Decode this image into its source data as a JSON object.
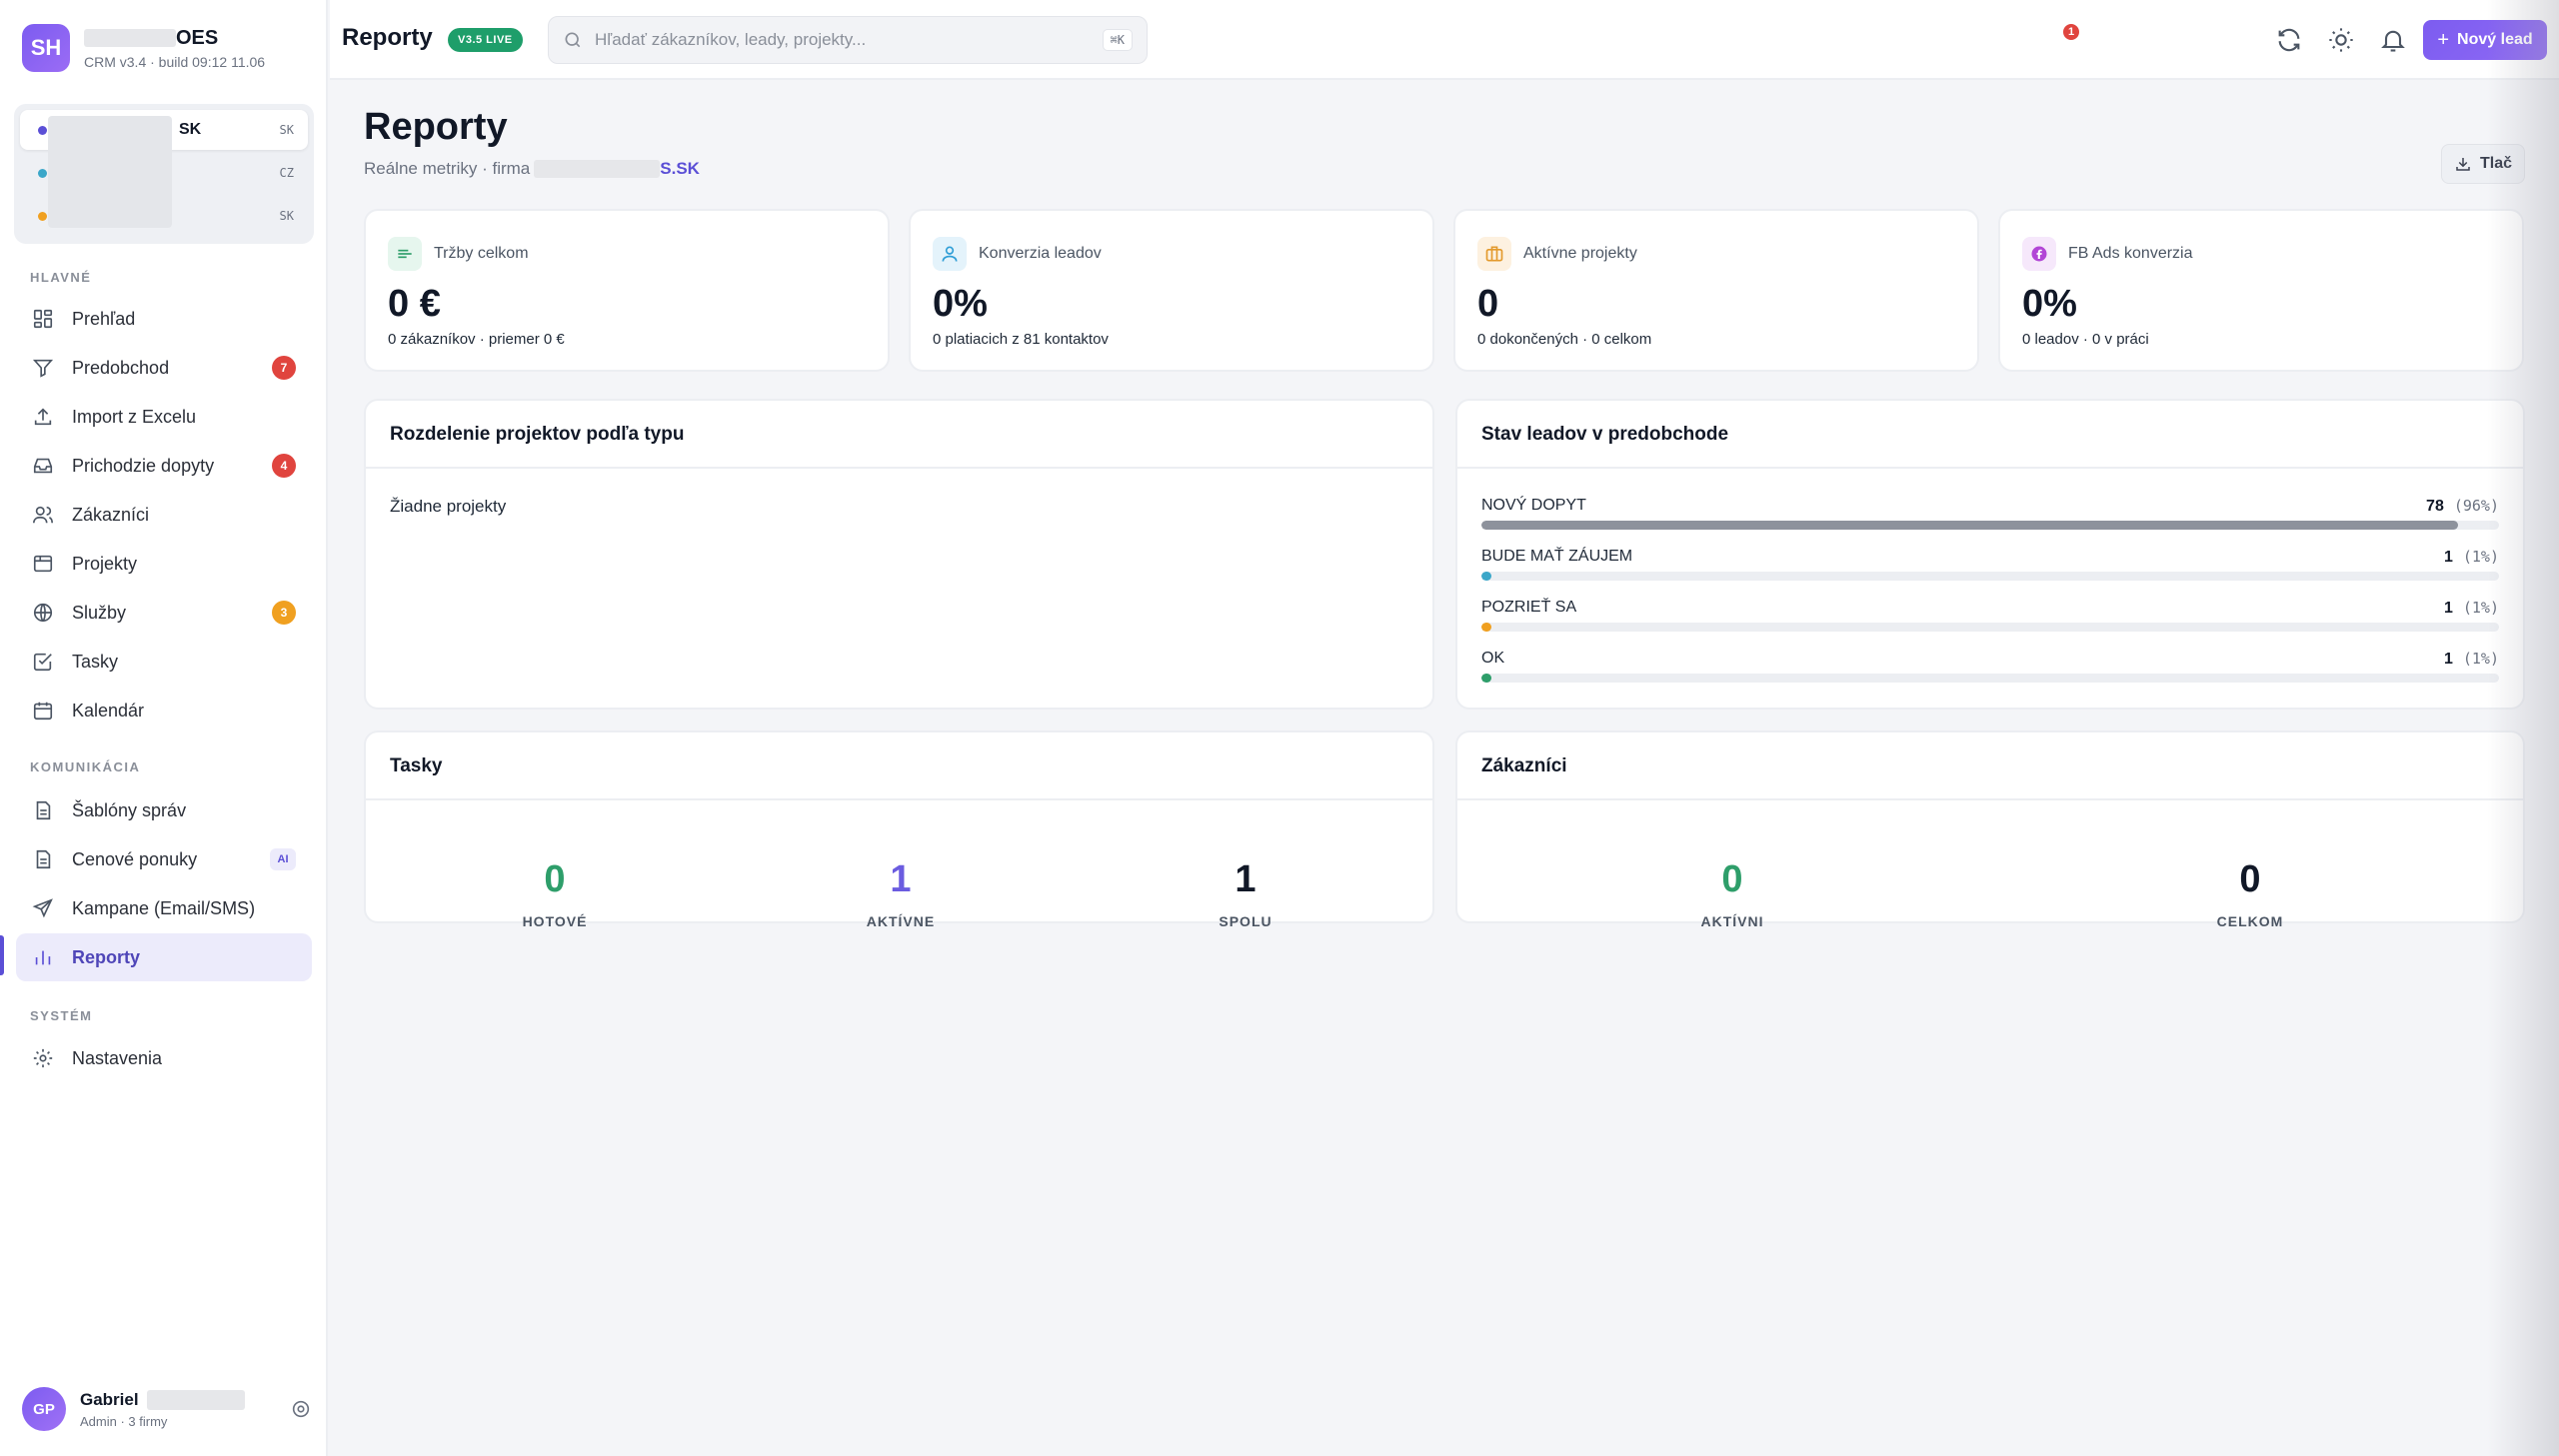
{
  "brand": {
    "initials": "SH",
    "name_suffix": "OES",
    "subtitle": "CRM v3.4 · build 09:12 11.06"
  },
  "companies": [
    {
      "name": "SK",
      "code": "SK",
      "color": "#5b4fd6"
    },
    {
      "name": "",
      "code": "CZ",
      "color": "#3ba7c9"
    },
    {
      "name": "",
      "code": "SK",
      "color": "#f0a020"
    }
  ],
  "nav": {
    "main_label": "HLAVNÉ",
    "main": [
      {
        "label": "Prehľad",
        "icon": "dashboard-icon"
      },
      {
        "label": "Predobchod",
        "icon": "funnel-icon",
        "badge": "7"
      },
      {
        "label": "Import z Excelu",
        "icon": "upload-icon"
      },
      {
        "label": "Prichodzie dopyty",
        "icon": "inbox-icon",
        "badge": "4"
      },
      {
        "label": "Zákazníci",
        "icon": "users-icon"
      },
      {
        "label": "Projekty",
        "icon": "folder-icon"
      },
      {
        "label": "Služby",
        "icon": "globe-icon",
        "badge": "3"
      },
      {
        "label": "Tasky",
        "icon": "checkbox-icon"
      },
      {
        "label": "Kalendár",
        "icon": "calendar-icon"
      }
    ],
    "comm_label": "KOMUNIKÁCIA",
    "comm": [
      {
        "label": "Šablóny správ",
        "icon": "document-icon"
      },
      {
        "label": "Cenové ponuky",
        "icon": "document-icon",
        "badge": "AI"
      },
      {
        "label": "Kampane (Email/SMS)",
        "icon": "send-icon"
      },
      {
        "label": "Reporty",
        "icon": "bar-chart-icon"
      }
    ],
    "system_label": "SYSTÉM",
    "system": [
      {
        "label": "Nastavenia",
        "icon": "gear-icon"
      }
    ]
  },
  "user": {
    "initials": "GP",
    "name": "Gabriel",
    "role": "Admin · 3 firmy"
  },
  "topbar": {
    "title": "Reporty",
    "live_badge": "V3.5 LIVE",
    "search_placeholder": "Hľadať zákazníkov, leady, projekty...",
    "search_shortcut": "⌘K",
    "notification_count": "1",
    "new_lead_label": "Nový lead"
  },
  "page": {
    "title": "Reporty",
    "subtitle": "Reálne metriky · firma",
    "firm_suffix": "S.SK",
    "print_label": "Tlač"
  },
  "kpis": [
    {
      "label": "Tržby celkom",
      "value": "0 €",
      "sub": "0 zákazníkov · priemer 0 €",
      "icon": "revenue-icon",
      "color": "#2e9e6a",
      "bg": "#e6f6ee"
    },
    {
      "label": "Konverzia leadov",
      "value": "0%",
      "sub": "0 platiacich z 81 kontaktov",
      "icon": "user-icon",
      "color": "#2f9ed6",
      "bg": "#e4f3fb"
    },
    {
      "label": "Aktívne projekty",
      "value": "0",
      "sub": "0 dokončených · 0 celkom",
      "icon": "briefcase-icon",
      "color": "#e39a2d",
      "bg": "#fdf1e0"
    },
    {
      "label": "FB Ads konverzia",
      "value": "0%",
      "sub": "0 leadov · 0 v práci",
      "icon": "facebook-icon",
      "color": "#b246d6",
      "bg": "#f6e8fb"
    }
  ],
  "projects_panel": {
    "title": "Rozdelenie projektov podľa typu",
    "empty": "Žiadne projekty"
  },
  "leads_panel": {
    "title": "Stav leadov v predobchode",
    "rows": [
      {
        "name": "Nový dopyt",
        "count": "78",
        "pct": "(96%)",
        "fraction": 0.96,
        "color": "#8d929c"
      },
      {
        "name": "Bude mať záujem",
        "count": "1",
        "pct": "(1%)",
        "fraction": 0.01,
        "color": "#3ba7c9"
      },
      {
        "name": "Pozrieť sa",
        "count": "1",
        "pct": "(1%)",
        "fraction": 0.01,
        "color": "#f0a020"
      },
      {
        "name": "OK",
        "count": "1",
        "pct": "(1%)",
        "fraction": 0.01,
        "color": "#2e9e6a"
      }
    ]
  },
  "tasks_panel": {
    "title": "Tasky",
    "stats": [
      {
        "value": "0",
        "label": "HOTOVÉ",
        "color": "#2e9e6a"
      },
      {
        "value": "1",
        "label": "AKTÍVNE",
        "color": "#6b5ce0"
      },
      {
        "value": "1",
        "label": "SPOLU",
        "color": "#111827"
      }
    ]
  },
  "customers_panel": {
    "title": "Zákazníci",
    "stats": [
      {
        "value": "0",
        "label": "AKTÍVNI",
        "color": "#2e9e6a"
      },
      {
        "value": "0",
        "label": "CELKOM",
        "color": "#111827"
      }
    ]
  }
}
